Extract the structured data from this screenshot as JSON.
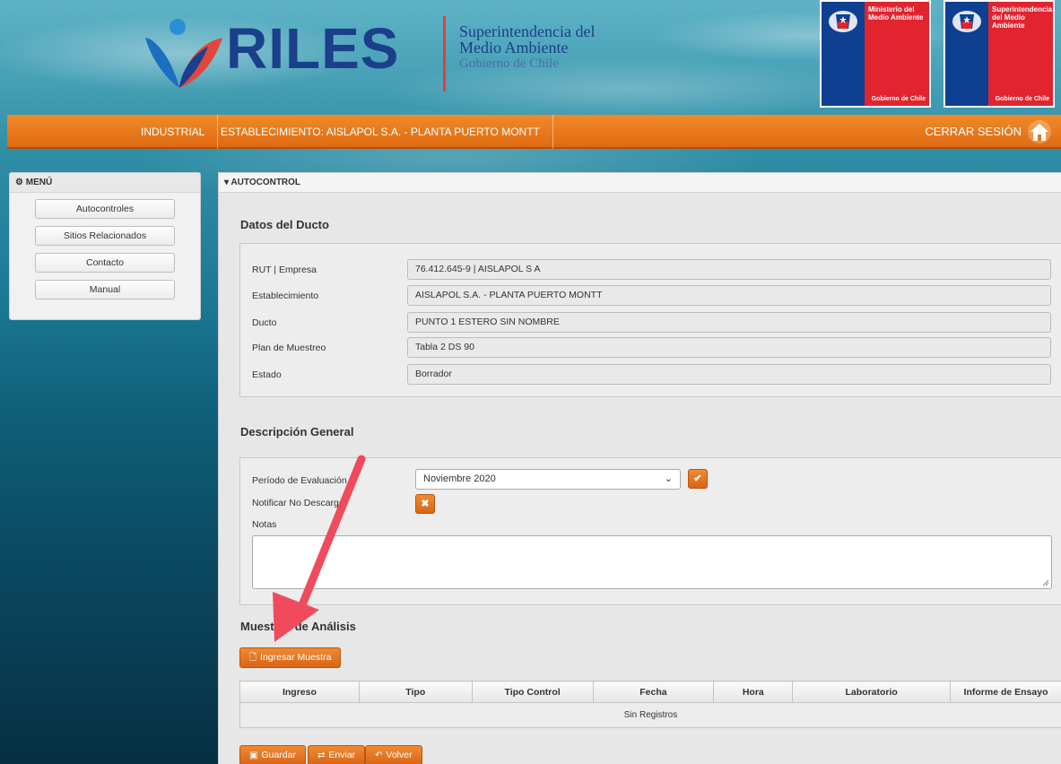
{
  "header": {
    "logo_text": "RILES",
    "org_line1": "Superintendencia del",
    "org_line2": "Medio Ambiente",
    "org_line3": "Gobierno de Chile",
    "card1_title": "Ministerio del Medio Ambiente",
    "card1_foot": "Gobierno de Chile",
    "card2_title": "Superintendencia del Medio Ambiente",
    "card2_foot": "Gobierno de Chile"
  },
  "nav": {
    "industrial": "INDUSTRIAL",
    "establecimiento": "ESTABLECIMIENTO: AISLAPOL S.A. - PLANTA PUERTO MONTT",
    "logout": "CERRAR SESIÓN",
    "home_icon": "home-icon"
  },
  "sidebar": {
    "title": "MENÚ",
    "items": [
      {
        "label": "Autocontroles"
      },
      {
        "label": "Sitios Relacionados"
      },
      {
        "label": "Contacto"
      },
      {
        "label": "Manual"
      }
    ]
  },
  "main": {
    "title": "AUTOCONTROL",
    "datos_title": "Datos del Ducto",
    "datos": [
      {
        "label": "RUT | Empresa",
        "value": "76.412.645-9 | AISLAPOL S A"
      },
      {
        "label": "Establecimiento",
        "value": "AISLAPOL S.A. - PLANTA PUERTO MONTT"
      },
      {
        "label": "Ducto",
        "value": "PUNTO 1 ESTERO SIN NOMBRE"
      },
      {
        "label": "Plan de Muestreo",
        "value": "Tabla 2 DS 90"
      },
      {
        "label": "Estado",
        "value": "Borrador"
      }
    ],
    "descripcion_title": "Descripción General",
    "periodo_label": "Período de Evaluación",
    "periodo_value": "Noviembre 2020",
    "notificar_label": "Notificar No Descarga",
    "notas_label": "Notas",
    "notas_value": "",
    "muestras_title": "Muestras de Análisis",
    "ingresar_label": "Ingresar Muestra",
    "table": {
      "headers": [
        "Ingreso",
        "Tipo",
        "Tipo Control",
        "Fecha",
        "Hora",
        "Laboratorio",
        "Informe de Ensayo"
      ],
      "empty_text": "Sin Registros"
    },
    "actions": {
      "guardar": "Guardar",
      "enviar": "Enviar",
      "volver": "Volver"
    }
  },
  "colors": {
    "accent_orange": "#e06a10",
    "brand_blue": "#1b3f8b",
    "annotation_arrow": "#ef4b5c"
  }
}
